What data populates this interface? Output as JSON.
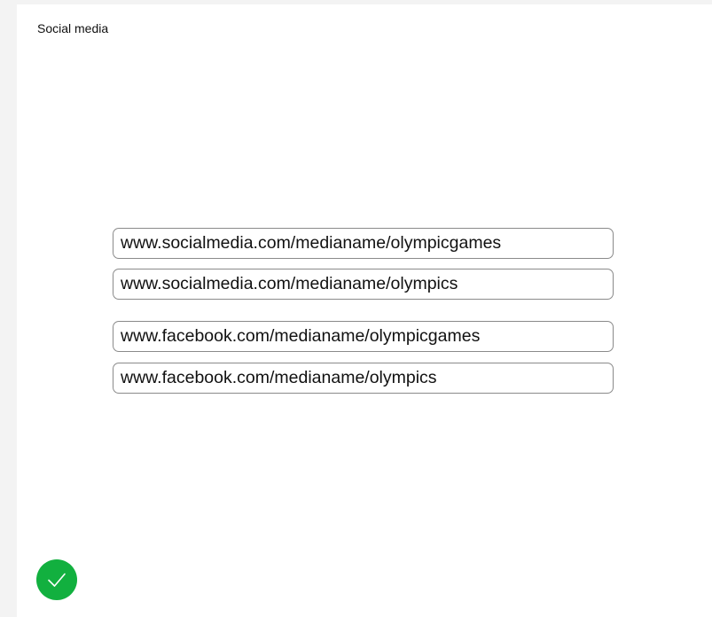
{
  "section": {
    "title": "Social media"
  },
  "links": [
    {
      "url": "www.socialmedia.com/medianame/olympicgames"
    },
    {
      "url": "www.socialmedia.com/medianame/olympics"
    },
    {
      "url": "www.facebook.com/medianame/olympicgames"
    },
    {
      "url": "www.facebook.com/medianame/olympics"
    }
  ],
  "confirm": {
    "icon": "check-icon",
    "color": "#12b03f"
  }
}
